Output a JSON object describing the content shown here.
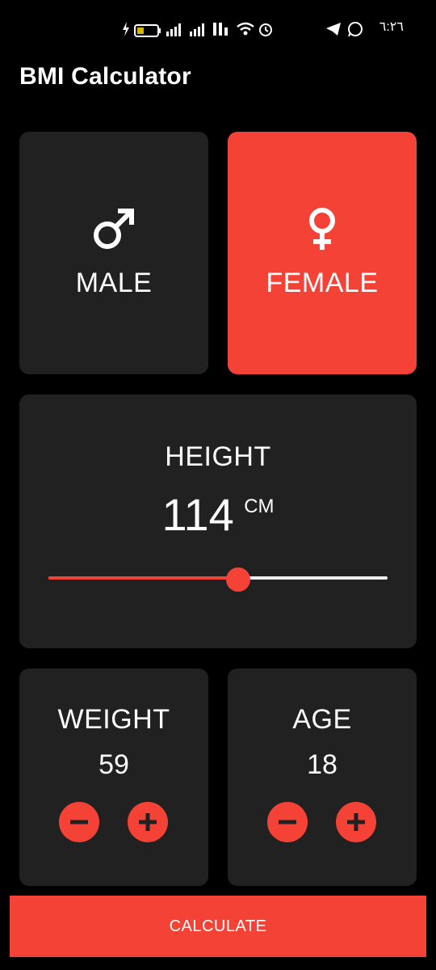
{
  "status_bar": {
    "time": "٦:٢٦",
    "icons": [
      "charging-icon",
      "battery-icon",
      "signal-icon",
      "signal-icon",
      "volte-icon",
      "wifi-icon",
      "alarm-icon",
      "telegram-icon",
      "whatsapp-icon"
    ]
  },
  "app_bar": {
    "title": "BMI Calculator"
  },
  "gender": {
    "male_label": "MALE",
    "female_label": "FEMALE",
    "selected": "female"
  },
  "height": {
    "title": "HEIGHT",
    "value": "114",
    "unit": "CM",
    "slider_fraction": 0.56
  },
  "weight": {
    "title": "WEIGHT",
    "value": "59"
  },
  "age": {
    "title": "AGE",
    "value": "18"
  },
  "calculate_label": "CALCULATE",
  "colors": {
    "accent": "#f44336",
    "card": "#212121",
    "background": "#000000",
    "text": "#ffffff"
  }
}
